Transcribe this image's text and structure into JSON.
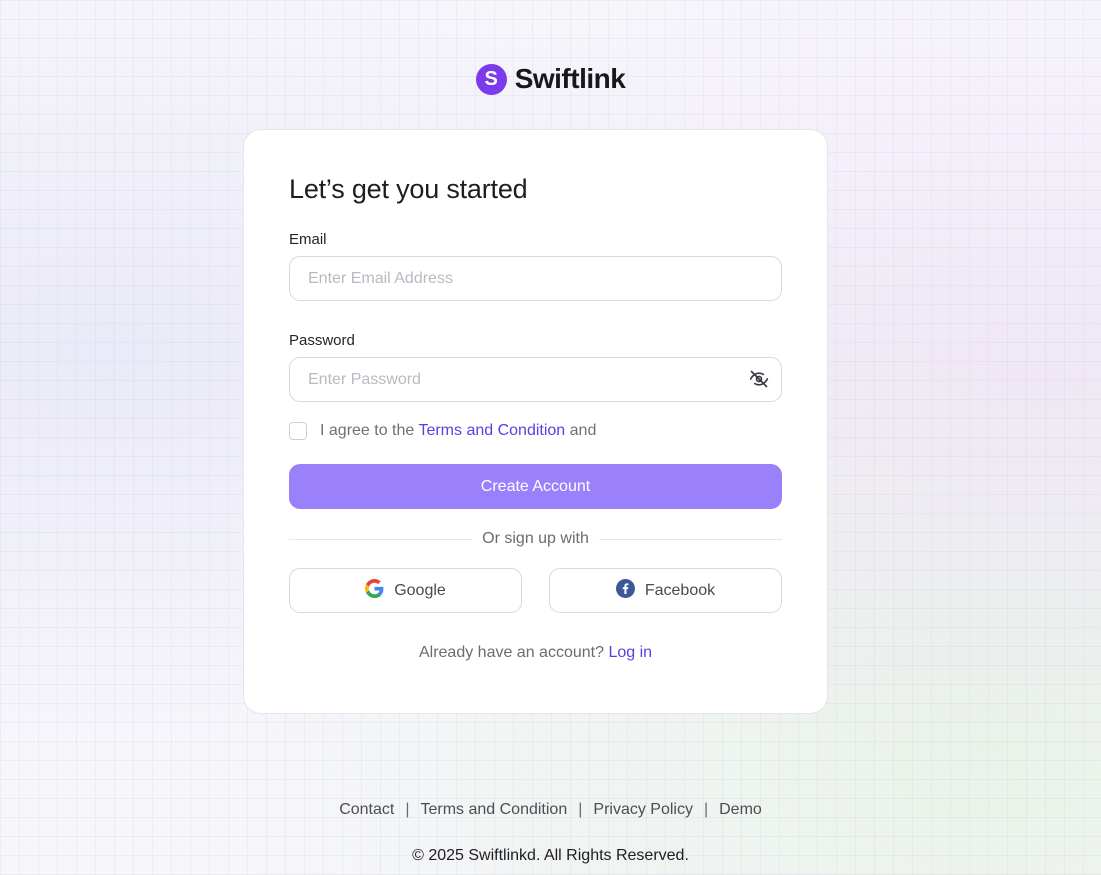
{
  "brand": {
    "name": "Swiftlink",
    "logo_letter": "S",
    "color": "#7c3aed"
  },
  "card": {
    "title": "Let’s get you started",
    "email": {
      "label": "Email",
      "placeholder": "Enter Email Address",
      "value": ""
    },
    "password": {
      "label": "Password",
      "placeholder": "Enter Password",
      "value": "",
      "toggle_icon": "eye-off-icon"
    },
    "agree": {
      "prefix": "I agree to the",
      "link": "Terms and Condition",
      "suffix": "and",
      "checked": false
    },
    "create_button": "Create Account",
    "divider_text": "Or sign up with",
    "social": {
      "google": "Google",
      "facebook": "Facebook"
    },
    "login_prompt": "Already have an account?",
    "login_link": "Log in"
  },
  "footer": {
    "links": [
      "Contact",
      "Terms and Condition",
      "Privacy Policy",
      "Demo"
    ],
    "copyright": "© 2025 Swiftlinkd. All Rights Reserved."
  },
  "colors": {
    "accent": "#9b80fb",
    "link": "#5b3fe0",
    "facebook": "#3b5998"
  }
}
